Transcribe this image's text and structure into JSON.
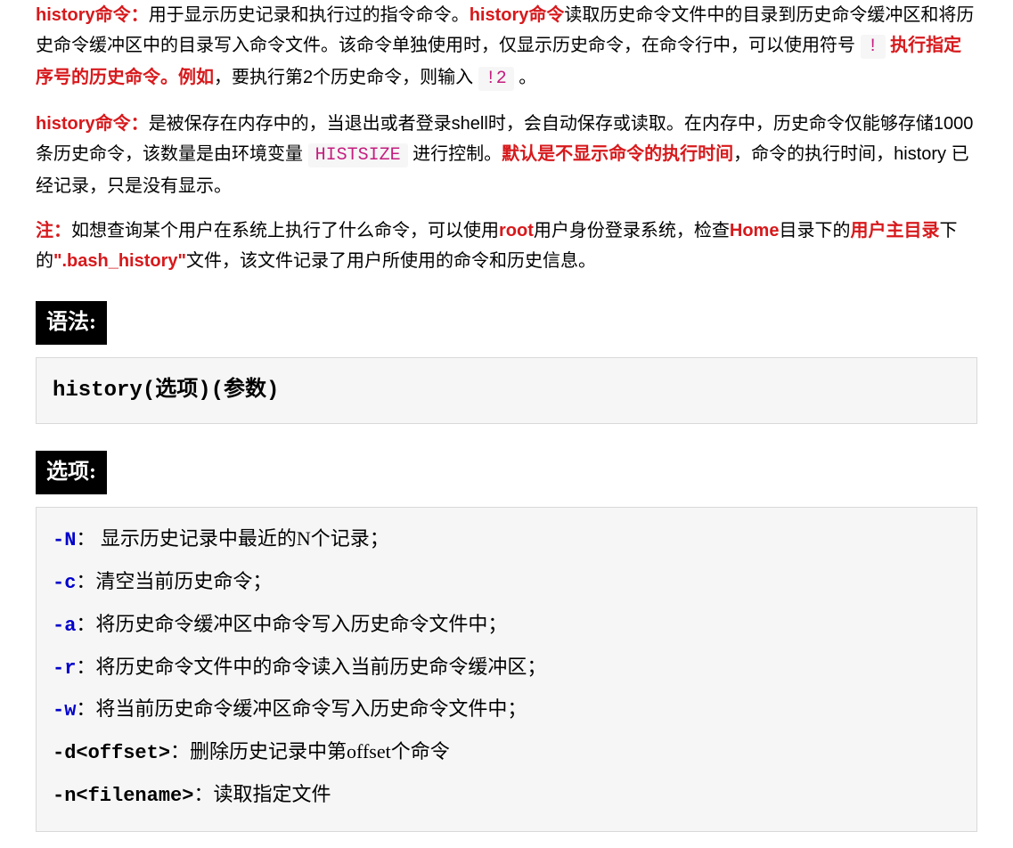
{
  "p1": {
    "s1": "history命令：",
    "s2": "用于显示历史记录和执行过的指令命令。",
    "s3": "history命令",
    "s4": "读取历史命令文件中的目录到历史命令缓冲区和将历史命令缓冲区中的目录写入命令文件。该命令单独使用时，仅显示历史命令，在命令行中，可以使用符号 ",
    "s5": "!",
    "s6": " 执行指定序号的历史命令。",
    "s7": "例如",
    "s8": "，要执行第2个历史命令，则输入 ",
    "s9": "!2",
    "s10": " 。"
  },
  "p2": {
    "s1": "history命令：",
    "s2": "是被保存在内存中的，当退出或者登录shell时，会自动保存或读取。在内存中，历史命令仅能够存储1000条历史命令，该数量是由环境变量 ",
    "s3": "HISTSIZE",
    "s4": " 进行控制。",
    "s5": "默认是不显示命令的执行时间",
    "s6": "，命令的执行时间，history 已经记录，只是没有显示。"
  },
  "p3": {
    "s1": "注：",
    "s2": "如想查询某个用户在系统上执行了什么命令，可以使用",
    "s3": "root",
    "s4": "用户身份登录系统，检查",
    "s5": "Home",
    "s6": "目录下的",
    "s7": "用户主目录",
    "s8": "下的",
    "s9": "\".bash_history\"",
    "s10": "文件，该文件记录了用户所使用的命令和历史信息。"
  },
  "headers": {
    "syntax": "语法:",
    "options": "选项:"
  },
  "syntax": "history(选项)(参数)",
  "opts": {
    "r1f": "-N",
    "r1c": "：",
    "r1d": " 显示历史记录中最近的N个记录；",
    "r2f": "-c",
    "r2c": "：",
    "r2d": "清空当前历史命令；",
    "r3f": "-a",
    "r3c": "：",
    "r3d": "将历史命令缓冲区中命令写入历史命令文件中；",
    "r4f": "-r",
    "r4c": "：",
    "r4d": "将历史命令文件中的命令读入当前历史命令缓冲区；",
    "r5f": "-w",
    "r5c": "：",
    "r5d": "将当前历史命令缓冲区命令写入历史命令文件中；",
    "r6f": "-d<offset>",
    "r6c": "：",
    "r6d": "删除历史记录中第offset个命令",
    "r7f": "-n<filename>",
    "r7c": "：",
    "r7d": "读取指定文件"
  }
}
